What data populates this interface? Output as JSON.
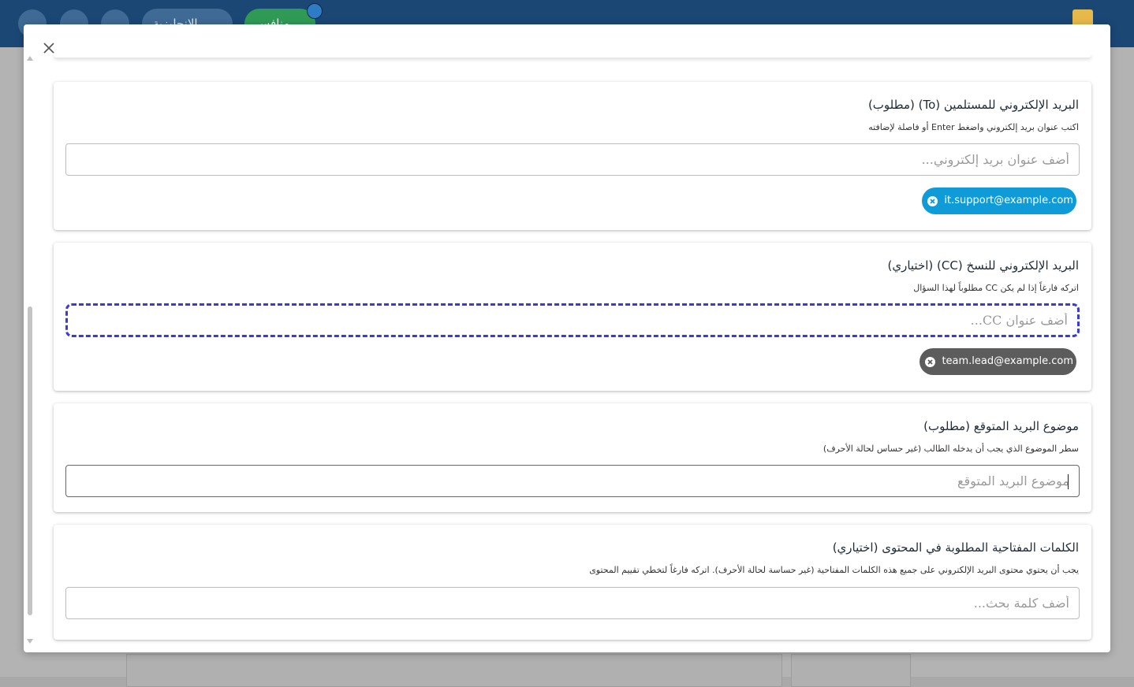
{
  "app_header": {
    "language_label": "الإنجليزية",
    "status_label": "منافس"
  },
  "modal": {
    "close_icon": "close-icon",
    "fields": {
      "to": {
        "title": "البريد الإلكتروني للمستلمين (To) (مطلوب)",
        "hint": "اكتب عنوان بريد إلكتروني واضغط Enter أو فاصلة لإضافته",
        "placeholder": "أضف عنوان بريد إلكتروني...",
        "chip": "it.support@example.com"
      },
      "cc": {
        "title": "البريد الإلكتروني للنسخ (CC) (اختياري)",
        "hint": "اتركه فارغاً إذا لم يكن CC مطلوباً لهذا السؤال",
        "placeholder": "أضف عنوان CC...",
        "chip": "team.lead@example.com"
      },
      "subject": {
        "title": "موضوع البريد المتوقع (مطلوب)",
        "hint": "سطر الموضوع الذي يجب أن يدخله الطالب (غير حساس لحالة الأحرف)",
        "placeholder": "موضوع البريد المتوقع"
      },
      "keywords": {
        "title": "الكلمات المفتاحية المطلوبة في المحتوى (اختياري)",
        "hint": "يجب أن يحتوي محتوى البريد الإلكتروني على جميع هذه الكلمات المفتاحية (غير حساسة لحالة الأحرف). اتركه فارغاً لتخطي تقييم المحتوى",
        "placeholder": "أضف كلمة بحث..."
      }
    }
  },
  "colors": {
    "header_bg": "#1b4775",
    "chip_to": "#0e9bd8",
    "chip_cc": "#5c5c5c",
    "focus_border": "#3a3ad6"
  }
}
